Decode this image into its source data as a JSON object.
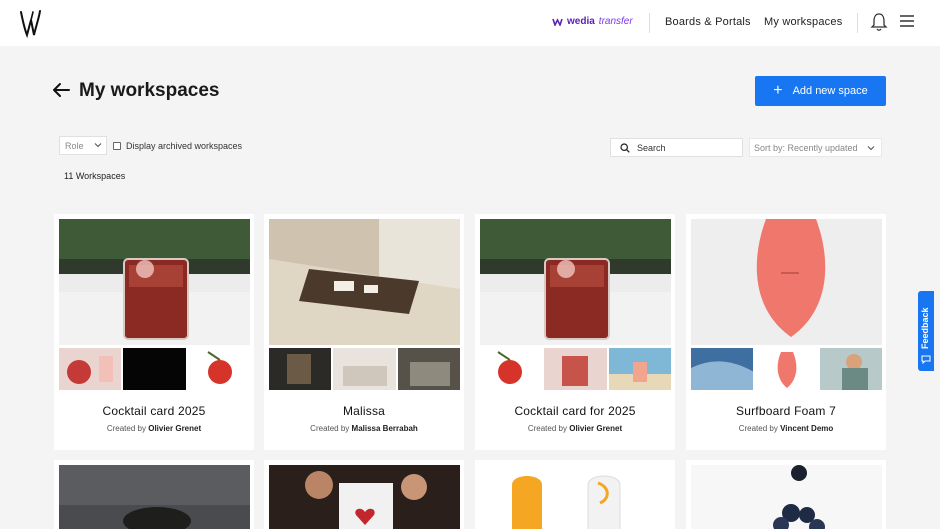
{
  "header": {
    "brand_strong": "wedia",
    "brand_light": "transfer",
    "nav": [
      "Boards & Portals",
      "My workspaces"
    ],
    "icons": [
      "logo-icon",
      "bell-icon",
      "menu-icon"
    ]
  },
  "page": {
    "title": "My workspaces",
    "add_button_label": "Add new space"
  },
  "filters": {
    "role_placeholder": "Role",
    "archived_label": "Display archived workspaces",
    "search_placeholder": "Search",
    "sort_label": "Sort by: Recently updated",
    "count_label": "11 Workspaces"
  },
  "cards": [
    {
      "name": "Cocktail card 2025",
      "created_prefix": "Created by",
      "creator": "Olivier Grenet"
    },
    {
      "name": "Malissa",
      "created_prefix": "Created by",
      "creator": "Malissa Berrabah"
    },
    {
      "name": "Cocktail card for 2025",
      "created_prefix": "Created by",
      "creator": "Olivier Grenet"
    },
    {
      "name": "Surfboard Foam 7",
      "created_prefix": "Created by",
      "creator": "Vincent Demo"
    }
  ],
  "feedback_label": "Feedback",
  "colors": {
    "accent": "#1976f2",
    "brand_purple": "#5b21b6",
    "background": "#f4f4f4"
  }
}
